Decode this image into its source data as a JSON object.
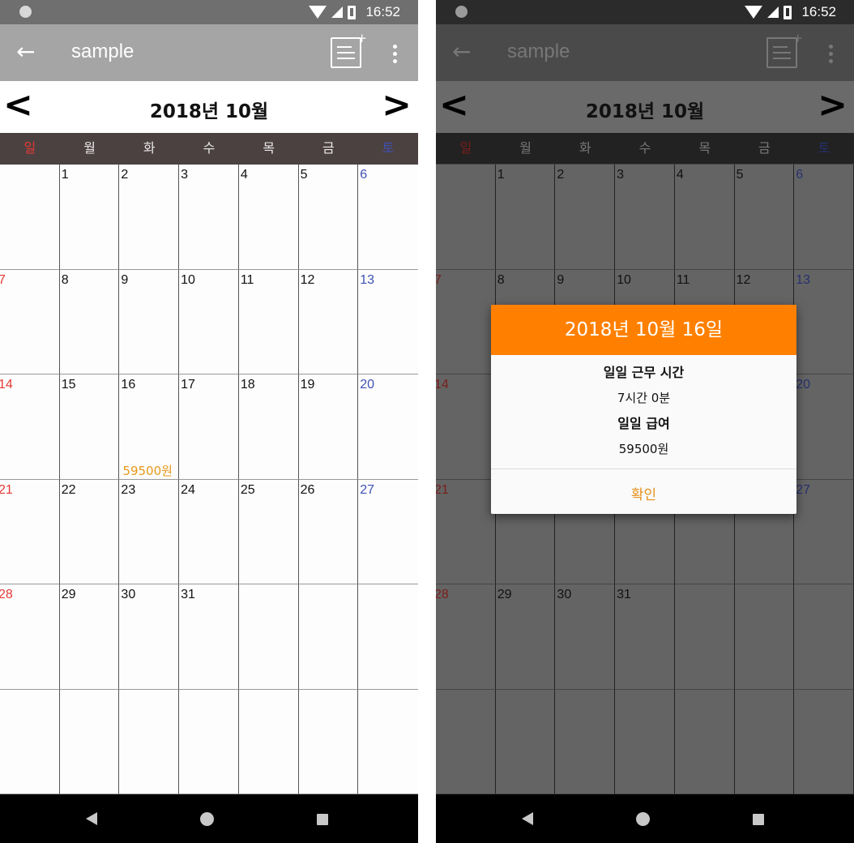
{
  "status": {
    "time": "16:52"
  },
  "appbar": {
    "title": "sample",
    "back_icon": "arrow-left-icon",
    "note_icon": "note-add-icon",
    "menu_icon": "more-vert-icon"
  },
  "calendar": {
    "month_title": "2018년 10월",
    "prev_icon": "chevron-left-icon",
    "next_icon": "chevron-right-icon",
    "weekdays": [
      "일",
      "월",
      "화",
      "수",
      "목",
      "금",
      "토"
    ],
    "weeks": [
      [
        "",
        "1",
        "2",
        "3",
        "4",
        "5",
        "6"
      ],
      [
        "7",
        "8",
        "9",
        "10",
        "11",
        "12",
        "13"
      ],
      [
        "14",
        "15",
        "16",
        "17",
        "18",
        "19",
        "20"
      ],
      [
        "21",
        "22",
        "23",
        "24",
        "25",
        "26",
        "27"
      ],
      [
        "28",
        "29",
        "30",
        "31",
        "",
        "",
        ""
      ],
      [
        "",
        "",
        "",
        "",
        "",
        "",
        ""
      ]
    ],
    "pay_entry": {
      "day": "16",
      "label": "59500원"
    }
  },
  "colors": {
    "sunday": "#e53935",
    "saturday": "#3f51b5",
    "accent": "#ff8000",
    "pay": "#e69a1a"
  },
  "dialog": {
    "title": "2018년 10월 16일",
    "work_hours_label": "일일 근무 시간",
    "work_hours_value": "7시간 0분",
    "pay_label": "일일 급여",
    "pay_value": "59500원",
    "confirm_label": "확인"
  }
}
